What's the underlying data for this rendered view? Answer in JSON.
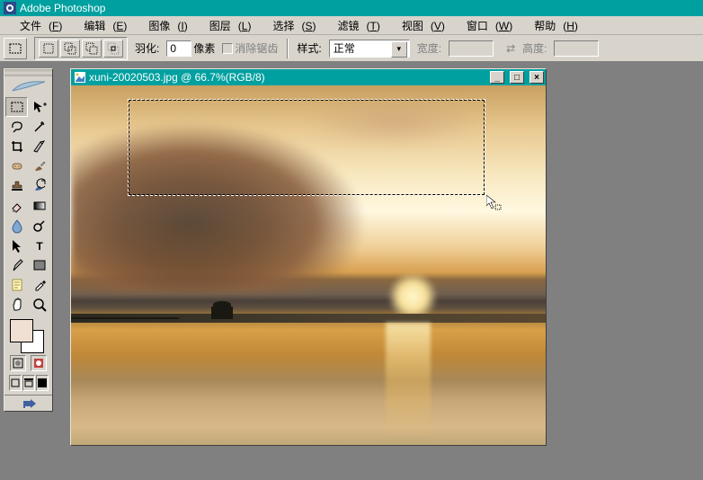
{
  "app": {
    "title": "Adobe Photoshop"
  },
  "menu": {
    "file": "文件",
    "file_k": "F",
    "edit": "编辑",
    "edit_k": "E",
    "image": "图像",
    "image_k": "I",
    "layer": "图层",
    "layer_k": "L",
    "select": "选择",
    "select_k": "S",
    "filter": "滤镜",
    "filter_k": "T",
    "view": "视图",
    "view_k": "V",
    "window": "窗口",
    "window_k": "W",
    "help": "帮助",
    "help_k": "H"
  },
  "options": {
    "feather_label": "羽化:",
    "feather_value": "0",
    "feather_unit": "像素",
    "antialias_label": "消除锯齿",
    "style_label": "样式:",
    "style_value": "正常",
    "width_label": "宽度:",
    "height_label": "高度:"
  },
  "document": {
    "title": "xuni-20020503.jpg @ 66.7%(RGB/8)"
  },
  "colors": {
    "foreground": "#f0e0d4",
    "titlebar": "#00a0a0"
  },
  "tools": [
    [
      "marquee-rect",
      "move"
    ],
    [
      "lasso",
      "wand"
    ],
    [
      "crop",
      "slice"
    ],
    [
      "healing",
      "brush"
    ],
    [
      "stamp",
      "history-brush"
    ],
    [
      "eraser",
      "gradient"
    ],
    [
      "blur",
      "dodge"
    ],
    [
      "path-select",
      "type"
    ],
    [
      "pen",
      "shape"
    ],
    [
      "notes",
      "eyedropper"
    ],
    [
      "hand",
      "zoom"
    ]
  ]
}
